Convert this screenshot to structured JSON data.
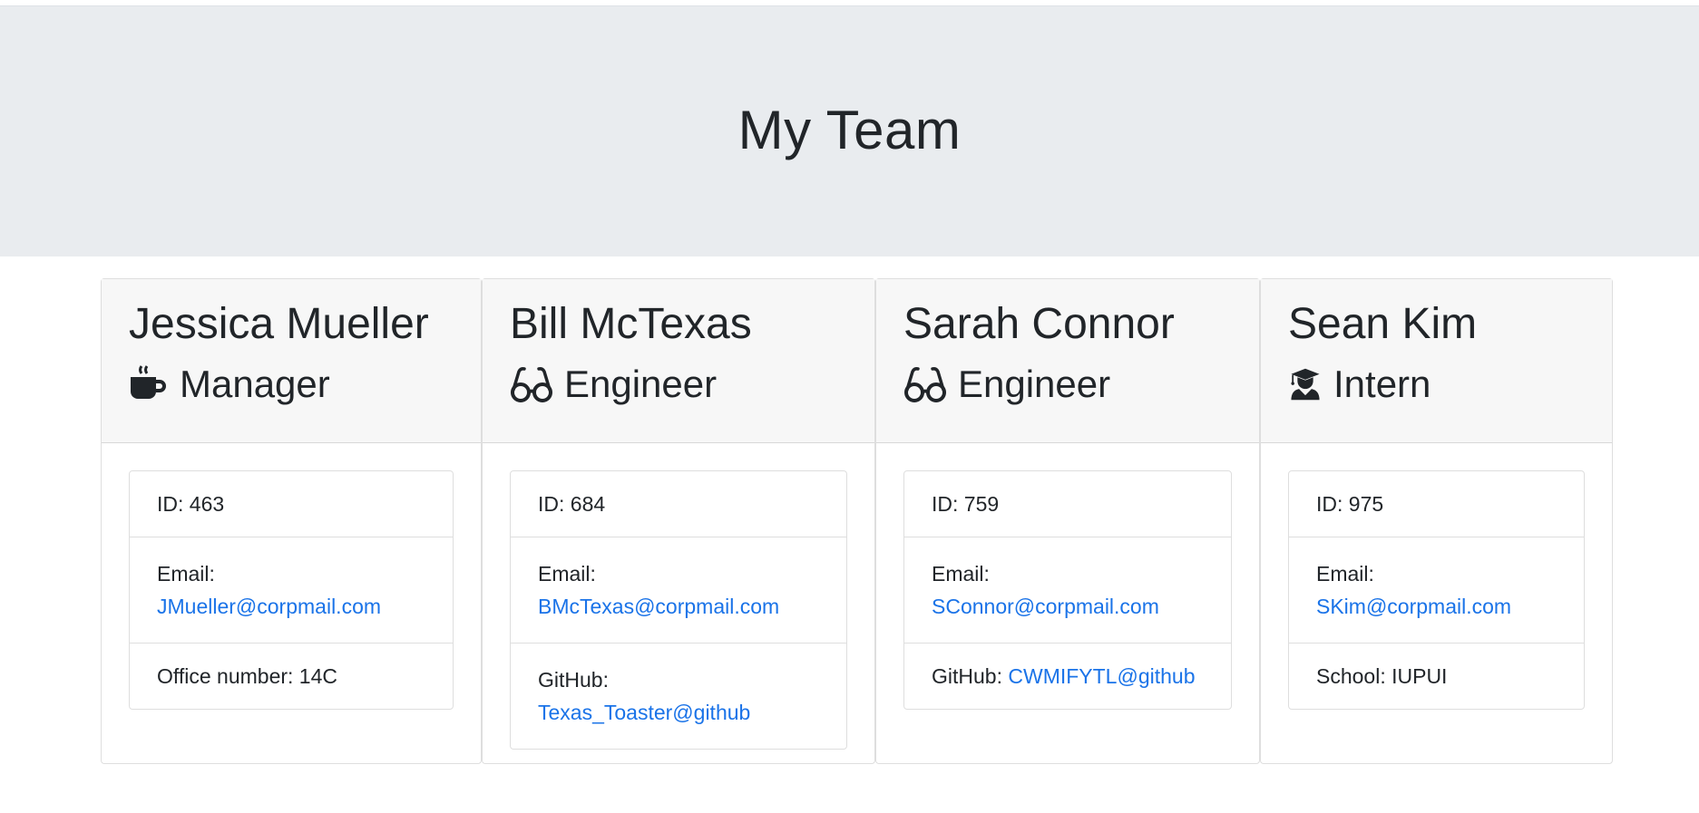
{
  "header": {
    "title": "My Team"
  },
  "employees": [
    {
      "name": "Jessica Mueller",
      "role": "Manager",
      "icon": "coffee-icon",
      "id_text": "ID: 463",
      "email_label": "Email:",
      "email": "JMueller@corpmail.com",
      "extra_label": "Office number: 14C",
      "extra_link": ""
    },
    {
      "name": "Bill McTexas",
      "role": "Engineer",
      "icon": "glasses-icon",
      "id_text": "ID: 684",
      "email_label": "Email:",
      "email": "BMcTexas@corpmail.com",
      "extra_label": "GitHub:",
      "extra_link": "Texas_Toaster@github"
    },
    {
      "name": "Sarah Connor",
      "role": "Engineer",
      "icon": "glasses-icon",
      "id_text": "ID: 759",
      "email_label": "Email:",
      "email": "SConnor@corpmail.com",
      "extra_label": "GitHub:",
      "extra_link": "CWMIFYTL@github"
    },
    {
      "name": "Sean Kim",
      "role": "Intern",
      "icon": "graduate-icon",
      "id_text": "ID: 975",
      "email_label": "Email:",
      "email": "SKim@corpmail.com",
      "extra_label": "School: IUPUI",
      "extra_link": ""
    }
  ],
  "colors": {
    "jumbotron": "#e9ecef",
    "card_header": "#f7f7f7",
    "link": "#1a73e8",
    "text": "#212529"
  }
}
